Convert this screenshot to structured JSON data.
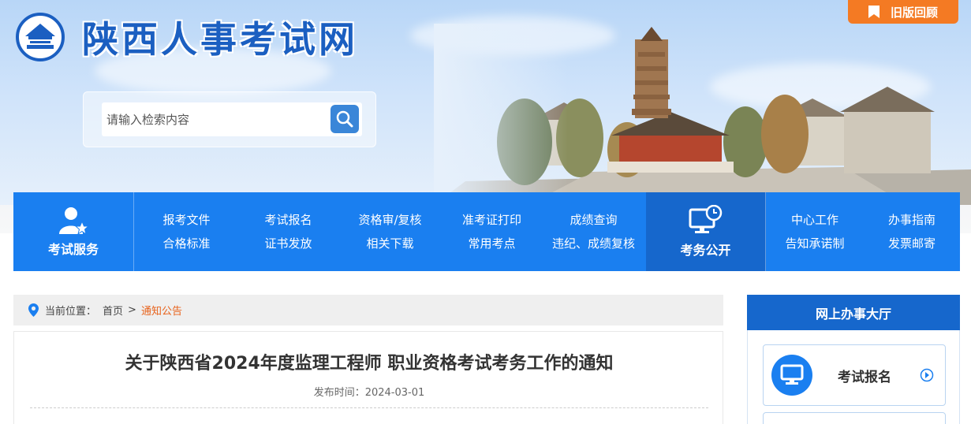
{
  "header": {
    "site_title": "陕西人事考试网",
    "old_version_label": "旧版回顾"
  },
  "search": {
    "placeholder": "请输入检索内容"
  },
  "nav": {
    "service_label": "考试服务",
    "links_row1": [
      "报考文件",
      "考试报名",
      "资格审/复核",
      "准考证打印",
      "成绩查询"
    ],
    "links_row2": [
      "合格标准",
      "证书发放",
      "相关下载",
      "常用考点",
      "违纪、成绩复核"
    ],
    "affairs_label": "考务公开",
    "right_row1": [
      "中心工作",
      "办事指南"
    ],
    "right_row2": [
      "告知承诺制",
      "发票邮寄"
    ]
  },
  "breadcrumb": {
    "prefix": "当前位置：",
    "home": "首页",
    "separator": ">",
    "current": "通知公告"
  },
  "article": {
    "title": "关于陕西省2024年度监理工程师 职业资格考试考务工作的通知",
    "date": "发布时间：2024-03-01"
  },
  "side_panel": {
    "title": "网上办事大厅",
    "card_label": "考试报名"
  },
  "colors": {
    "brand_blue": "#1a7ff0",
    "dark_blue": "#1667cc",
    "accent_orange": "#f47a23",
    "breadcrumb_current": "#e8631c"
  },
  "icons": {
    "logo": "pagoda-emblem-icon",
    "old_version": "bookmark-icon",
    "search": "search-icon",
    "service": "user-star-icon",
    "affairs": "monitor-clock-icon",
    "breadcrumb": "location-pin-icon",
    "card": "monitor-icon",
    "card_arrow": "circle-arrow-right-icon"
  }
}
